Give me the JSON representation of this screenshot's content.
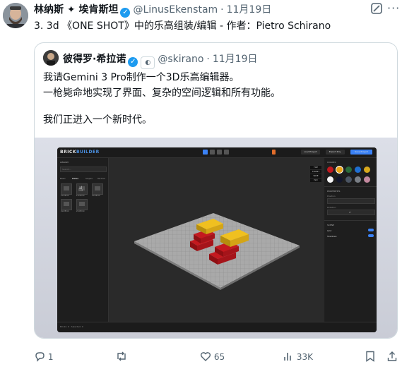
{
  "tweet": {
    "author_name": "林纳斯 ✦ 埃肯斯坦",
    "verified_glyph": "✓",
    "handle": "@LinusEkenstam",
    "separator": "·",
    "date": "11月19日",
    "text": "3. 3d 《ONE SHOT》中的乐高组装/编辑 - 作者：Pietro Schirano"
  },
  "quote": {
    "author_name": "彼得罗·希拉诺",
    "verified_glyph": "✓",
    "handle": "@skirano",
    "separator": "·",
    "date": "11月19日",
    "lines": [
      "我请Gemini 3 Pro制作一个3D乐高编辑器。",
      "一枪毙命地实现了界面、复杂的空间逻辑和所有功能。",
      "",
      "我们正进入一个新时代。"
    ]
  },
  "app": {
    "logo_a": "BRICK",
    "logo_b": "BUILDER",
    "top_buttons": [
      "Load Project",
      "Export Proj.",
      "Save Project"
    ],
    "left_title": "LIBRARY",
    "search_placeholder": "Search...",
    "categories": [
      "Basic",
      "Plates",
      "Slopes",
      "Technic"
    ],
    "pieces": [
      "1x1 Brick",
      "1x2 Brick",
      "1x4 Brick",
      "2x2 Brick",
      "2x4 Brick"
    ],
    "view_buttons": [
      "TOP",
      "FRONT",
      "SIDE",
      "ISO"
    ],
    "colors_title": "COLORS",
    "swatches": [
      "#c0191f",
      "#e8a317",
      "#2a6b3a",
      "#1f6fd1",
      "#d9a91d",
      "#f5f5f5",
      "#12162b",
      "#4b5563",
      "#7a7f86",
      "#c48aa0"
    ],
    "properties_title": "PROPERTIES",
    "position_label": "Position",
    "rotation_label": "Rotation",
    "rotation_value": "0°",
    "scene_title": "SCENE",
    "toggles": [
      "Grid",
      "Shadows"
    ],
    "status_text": "Bricks: 6 · Selected: 0"
  },
  "actions": {
    "replies": "1",
    "retweets": "",
    "likes": "65",
    "views": "33K"
  },
  "icons": [
    "reply-icon",
    "retweet-icon",
    "like-icon",
    "views-icon",
    "bookmark-icon",
    "share-icon",
    "grok-icon",
    "more-icon"
  ]
}
